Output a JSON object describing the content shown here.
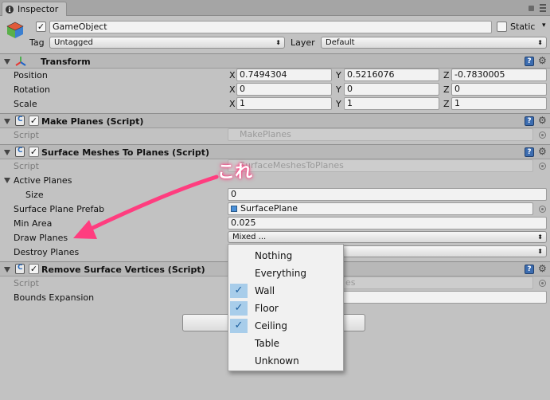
{
  "window": {
    "tab_label": "Inspector"
  },
  "gameobject": {
    "name": "GameObject",
    "static_label": "Static",
    "tag_label": "Tag",
    "tag_value": "Untagged",
    "layer_label": "Layer",
    "layer_value": "Default"
  },
  "transform": {
    "title": "Transform",
    "position_label": "Position",
    "rotation_label": "Rotation",
    "scale_label": "Scale",
    "axis_x": "X",
    "axis_y": "Y",
    "axis_z": "Z",
    "position": {
      "x": "0.7494304",
      "y": "0.5216076",
      "z": "-0.7830005"
    },
    "rotation": {
      "x": "0",
      "y": "0",
      "z": "0"
    },
    "scale": {
      "x": "1",
      "y": "1",
      "z": "1"
    }
  },
  "make_planes": {
    "title": "Make Planes (Script)",
    "script_label": "Script",
    "script_value": "MakePlanes"
  },
  "surface_meshes": {
    "title": "Surface Meshes To Planes (Script)",
    "script_label": "Script",
    "script_value": "SurfaceMeshesToPlanes",
    "active_planes_label": "Active Planes",
    "size_label": "Size",
    "size_value": "0",
    "prefab_label": "Surface Plane Prefab",
    "prefab_value": "SurfacePlane",
    "min_area_label": "Min Area",
    "min_area_value": "0.025",
    "draw_planes_label": "Draw Planes",
    "draw_planes_value": "Mixed ...",
    "destroy_planes_label": "Destroy Planes"
  },
  "remove_vertices": {
    "title": "Remove Surface Vertices (Script)",
    "script_label": "Script",
    "script_value_tail": "es",
    "bounds_label": "Bounds Expansion"
  },
  "dropdown_menu": {
    "items": [
      {
        "label": "Nothing",
        "checked": false
      },
      {
        "label": "Everything",
        "checked": false
      },
      {
        "label": "Wall",
        "checked": true
      },
      {
        "label": "Floor",
        "checked": true
      },
      {
        "label": "Ceiling",
        "checked": true
      },
      {
        "label": "Table",
        "checked": false
      },
      {
        "label": "Unknown",
        "checked": false
      }
    ]
  },
  "annotation": {
    "text": "これ",
    "color": "#ff3d7f"
  },
  "colors": {
    "panel_bg": "#c2c2c2",
    "header_bg": "#b8b8b8",
    "check_highlight": "#a8cdea",
    "annotation_pink": "#ff3d7f"
  },
  "icons": {
    "tab": "info-icon",
    "help": "help-book-icon",
    "settings": "gear-icon",
    "script": "csharp-script-icon",
    "object_picker": "target-icon"
  }
}
